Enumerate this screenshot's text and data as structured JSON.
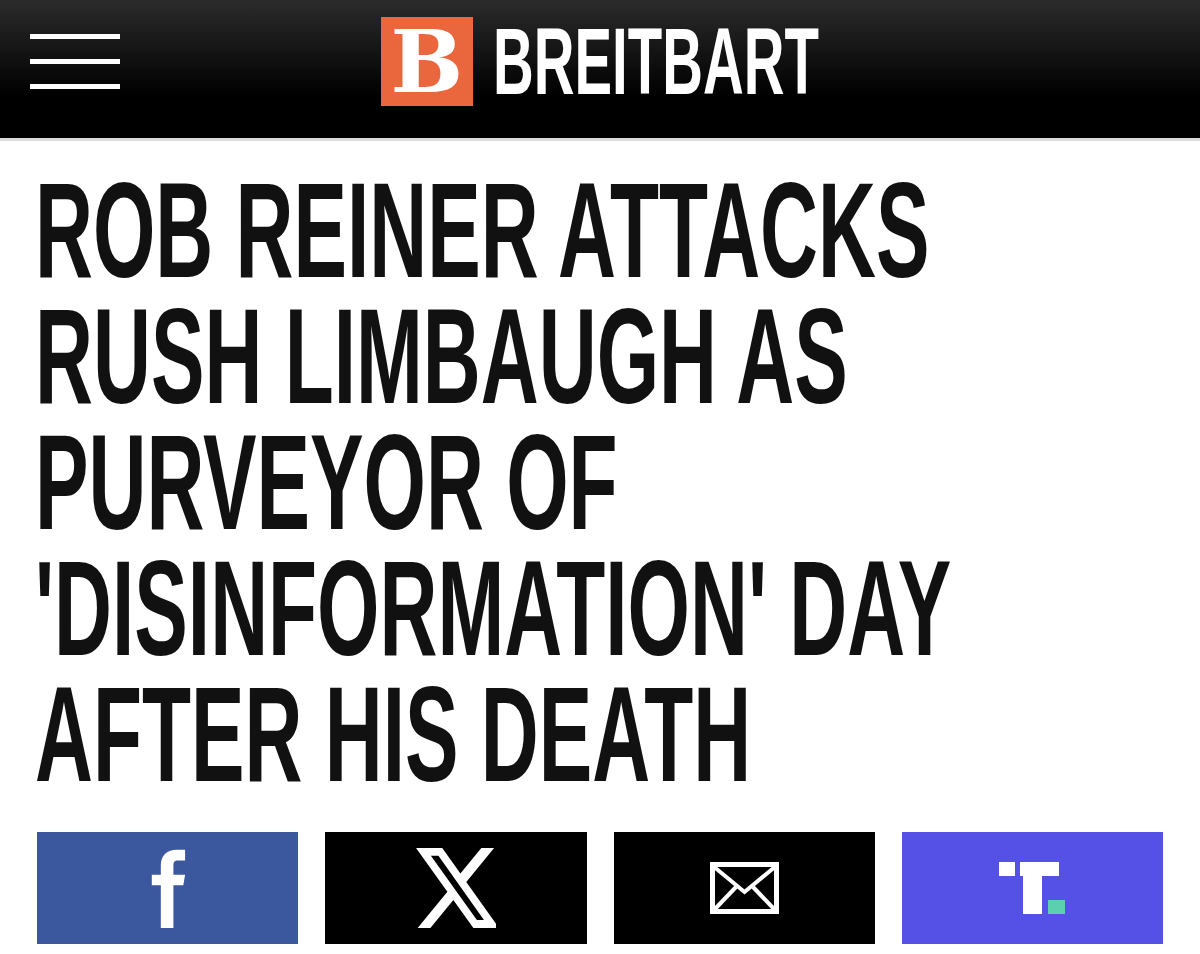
{
  "header": {
    "logo_letter": "B",
    "site_name": "BREITBART"
  },
  "headline": "ROB REINER ATTACKS RUSH LIMBAUGH AS PURVEYOR OF 'DISINFORMATION' DAY AFTER HIS DEATH",
  "share_buttons": [
    {
      "kind": "facebook",
      "color": "#3b579d"
    },
    {
      "kind": "x",
      "color": "#000000"
    },
    {
      "kind": "email",
      "color": "#000000"
    },
    {
      "kind": "truth_social",
      "color": "#5551e6"
    }
  ]
}
